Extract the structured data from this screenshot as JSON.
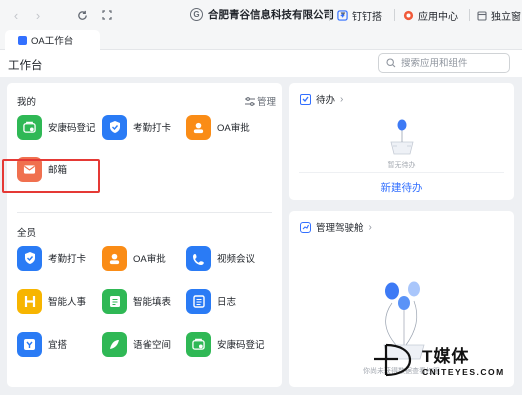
{
  "titlebar": {
    "org_initial": "G",
    "org_name": "合肥青谷信息科技有限公司",
    "dingding_label": "钉钉搭",
    "app_center_label": "应用中心",
    "standalone_label": "独立窗口"
  },
  "tab": {
    "label": "OA工作台"
  },
  "header": {
    "title": "工作台",
    "search_placeholder": "搜索应用和组件"
  },
  "mine": {
    "title": "我的",
    "manage_label": "管理",
    "apps": [
      {
        "label": "安康码登记",
        "icon": "health-code-icon",
        "color": "#2fb855"
      },
      {
        "label": "考勤打卡",
        "icon": "attendance-icon",
        "color": "#2a7bf5"
      },
      {
        "label": "OA审批",
        "icon": "approval-icon",
        "color": "#fa8c16"
      },
      {
        "label": "邮箱",
        "icon": "mail-icon",
        "color": "#f0704f"
      }
    ]
  },
  "all": {
    "title": "全员",
    "apps": [
      {
        "label": "考勤打卡",
        "icon": "attendance-icon",
        "color": "#2a7bf5"
      },
      {
        "label": "OA审批",
        "icon": "approval-icon",
        "color": "#fa8c16"
      },
      {
        "label": "视频会议",
        "icon": "video-icon",
        "color": "#2a7bf5"
      },
      {
        "label": "智能人事",
        "icon": "hr-icon",
        "color": "#f7b500"
      },
      {
        "label": "智能填表",
        "icon": "form-icon",
        "color": "#2fb855"
      },
      {
        "label": "日志",
        "icon": "log-icon",
        "color": "#2a7bf5"
      },
      {
        "label": "宜搭",
        "icon": "yida-icon",
        "color": "#2a7bf5"
      },
      {
        "label": "语雀空间",
        "icon": "yuque-icon",
        "color": "#2fb855"
      },
      {
        "label": "安康码登记",
        "icon": "health-code-icon",
        "color": "#2fb855"
      }
    ]
  },
  "todo": {
    "title": "待办",
    "empty_text": "暂无待办",
    "new_label": "新建待办"
  },
  "cockpit": {
    "title": "管理驾驶舱",
    "empty_text": "你尚未获得数据查看权限"
  },
  "watermark": {
    "main": "T媒体",
    "sub": "CNITEYES.COM"
  }
}
